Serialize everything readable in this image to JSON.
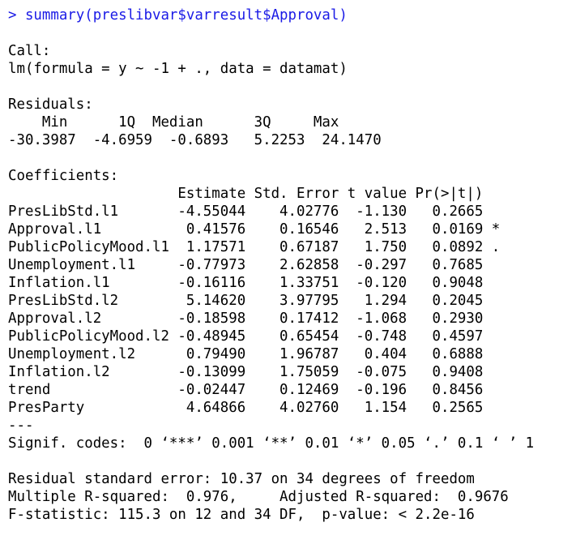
{
  "prompt_line": "> summary(preslibvar$varresult$Approval)",
  "call_header": "Call:",
  "call_formula": "lm(formula = y ~ -1 + ., data = datamat)",
  "residuals_header": "Residuals:",
  "residuals_labels": "    Min      1Q  Median      3Q     Max ",
  "residuals_values": "-30.3987  -4.6959  -0.6893   5.2253  24.1470 ",
  "coefficients_header": "Coefficients:",
  "coef_col_header": "                    Estimate Std. Error t value Pr(>|t|)  ",
  "coef_rows": [
    "PresLibStd.l1       -4.55044    4.02776  -1.130   0.2665  ",
    "Approval.l1          0.41576    0.16546   2.513   0.0169 *",
    "PublicPolicyMood.l1  1.17571    0.67187   1.750   0.0892 .",
    "Unemployment.l1     -0.77973    2.62858  -0.297   0.7685  ",
    "Inflation.l1        -0.16116    1.33751  -0.120   0.9048  ",
    "PresLibStd.l2        5.14620    3.97795   1.294   0.2045  ",
    "Approval.l2         -0.18598    0.17412  -1.068   0.2930  ",
    "PublicPolicyMood.l2 -0.48945    0.65454  -0.748   0.4597  ",
    "Unemployment.l2      0.79490    1.96787   0.404   0.6888  ",
    "Inflation.l2        -0.13099    1.75059  -0.075   0.9408  ",
    "trend               -0.02447    0.12469  -0.196   0.8456  ",
    "PresParty            4.64866    4.02760   1.154   0.2565  "
  ],
  "separator": "---",
  "signif_codes": "Signif. codes:  0 ‘***’ 0.001 ‘**’ 0.01 ‘*’ 0.05 ‘.’ 0.1 ‘ ’ 1",
  "residual_se": "Residual standard error: 10.37 on 34 degrees of freedom",
  "r_squared": "Multiple R-squared:  0.976,\tAdjusted R-squared:  0.9676 ",
  "f_statistic": "F-statistic: 115.3 on 12 and 34 DF,  p-value: < 2.2e-16",
  "colors": {
    "command": "#1a1ae6",
    "output": "#000000",
    "background": "#ffffff"
  }
}
